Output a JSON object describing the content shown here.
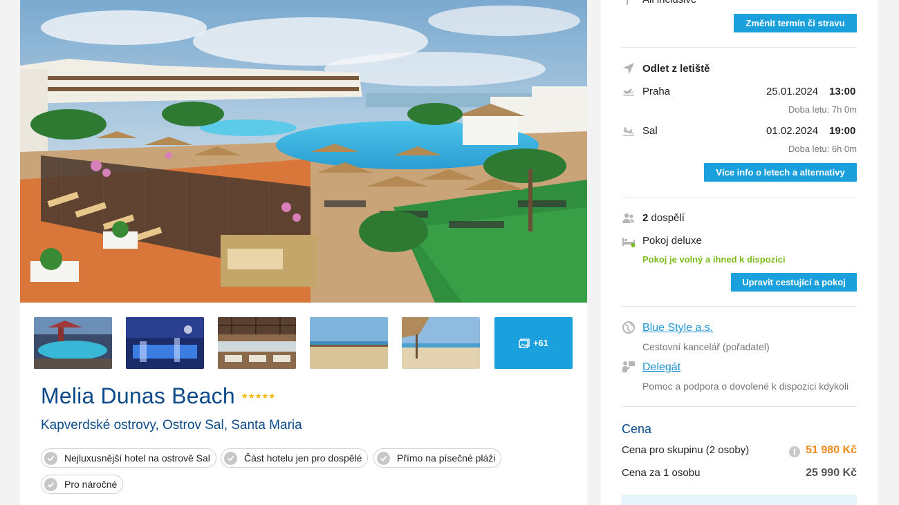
{
  "hotel": {
    "name": "Melia Dunas Beach",
    "stars": "★★★★★",
    "location": "Kapverdské ostrovy, Ostrov Sal, Santa Maria",
    "tags": [
      "Nejluxusnější hotel na ostrově Sal",
      "Část hotelu jen pro dospělé",
      "Přímo na písečné pláži",
      "Pro náročné"
    ]
  },
  "gallery": {
    "more_label": "+61",
    "thumbnails": [
      "pool-night",
      "bar-blue",
      "restaurant-terrace",
      "beach-dunes",
      "beach-hut"
    ]
  },
  "sidebar": {
    "board_label": "All inclusive",
    "change_term_button": "Změnit termín či stravu",
    "flight": {
      "heading": "Odlet z letiště",
      "outbound": {
        "city": "Praha",
        "date": "25.01.2024",
        "time": "13:00",
        "duration": "Doba letu: 7h 0m"
      },
      "inbound": {
        "city": "Sal",
        "date": "01.02.2024",
        "time": "19:00",
        "duration": "Doba letu: 6h 0m"
      },
      "more_button": "Více info o letech a alternativy"
    },
    "travellers": {
      "count": "2",
      "label": "dospělí",
      "room": "Pokoj deluxe",
      "availability": "Pokoj je volný a ihned k dispozici",
      "edit_button": "Upravit cestující a pokoj"
    },
    "agency": {
      "name": "Blue Style a.s.",
      "role": "Cestovní kancelář (pořadatel)",
      "delegate": "Delegát",
      "delegate_desc": "Pomoc a podpora o dovolené k dispozici kdykoli"
    },
    "price": {
      "heading": "Cena",
      "group_label": "Cena pro skupinu (2 osoby)",
      "group_value": "51 980 Kč",
      "info_icon": "i",
      "person_label": "Cena za 1 osobu",
      "person_value": "25 990 Kč"
    }
  },
  "colors": {
    "accent": "#1aa0dc",
    "title_blue": "#0b4a8a",
    "price_orange": "#f08a1c",
    "available_green": "#7cbb1b"
  }
}
